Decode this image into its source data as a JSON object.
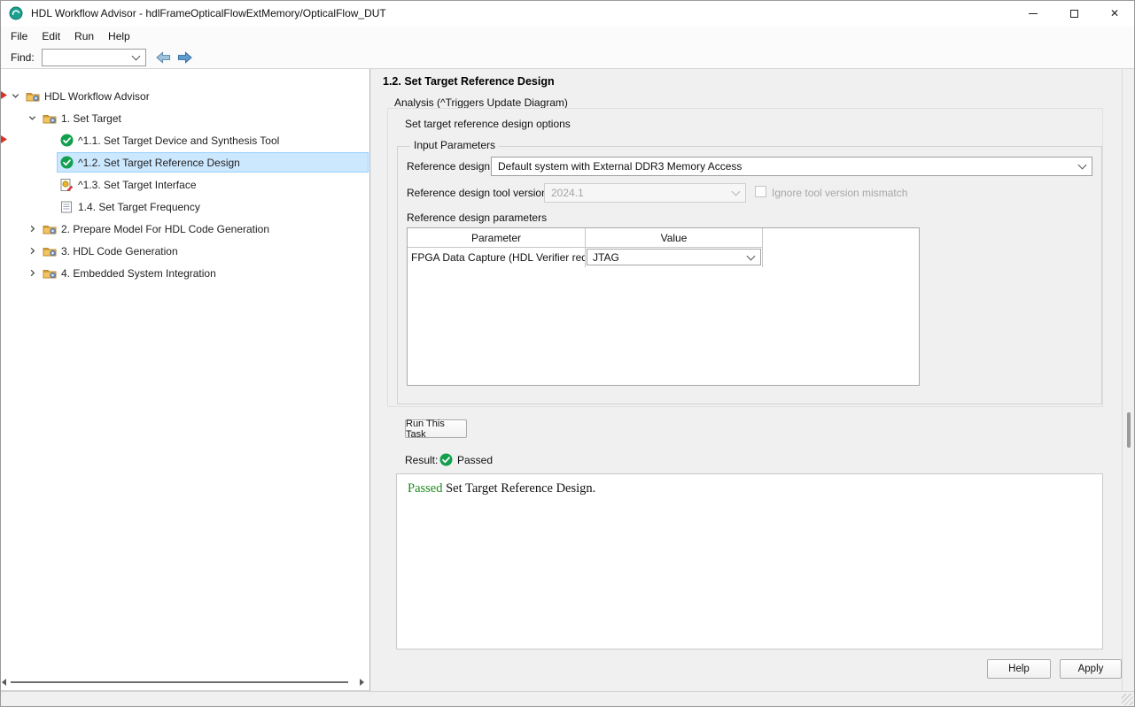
{
  "window": {
    "title": "HDL Workflow Advisor - hdlFrameOpticalFlowExtMemory/OpticalFlow_DUT"
  },
  "menu": {
    "items": [
      "File",
      "Edit",
      "Run",
      "Help"
    ]
  },
  "toolbar": {
    "find_label": "Find:",
    "find_value": ""
  },
  "tree": {
    "items": [
      {
        "label": "HDL Workflow Advisor",
        "level": 0,
        "icon": "workflow-folder",
        "chevron": "expanded",
        "selected": false
      },
      {
        "label": "1. Set Target",
        "level": 1,
        "icon": "task-folder",
        "chevron": "expanded",
        "selected": false
      },
      {
        "label": "^1.1. Set Target Device and Synthesis Tool",
        "level": 2,
        "icon": "passed-check",
        "chevron": "none",
        "selected": false
      },
      {
        "label": "^1.2. Set Target Reference Design",
        "level": 2,
        "icon": "passed-check",
        "chevron": "none",
        "selected": true
      },
      {
        "label": "^1.3. Set Target Interface",
        "level": 2,
        "icon": "task-edit",
        "chevron": "none",
        "selected": false
      },
      {
        "label": "1.4. Set Target Frequency",
        "level": 2,
        "icon": "report",
        "chevron": "none",
        "selected": false
      },
      {
        "label": "2. Prepare Model For HDL Code Generation",
        "level": 1,
        "icon": "task-folder",
        "chevron": "collapsed",
        "selected": false
      },
      {
        "label": "3. HDL Code Generation",
        "level": 1,
        "icon": "task-folder",
        "chevron": "collapsed",
        "selected": false
      },
      {
        "label": "4. Embedded System Integration",
        "level": 1,
        "icon": "task-folder",
        "chevron": "collapsed",
        "selected": false
      }
    ]
  },
  "panel": {
    "title": "1.2. Set Target Reference Design",
    "analysis_label": "Analysis (^Triggers Update Diagram)",
    "options_label": "Set target reference design options",
    "input_parameters": {
      "legend": "Input Parameters",
      "reference_design": {
        "label": "Reference design:",
        "value": "Default system with External DDR3 Memory Access"
      },
      "tool_version": {
        "label": "Reference design tool version:",
        "value": "2024.1"
      },
      "ignore_mismatch_label": "Ignore tool version mismatch",
      "ignore_mismatch_checked": false,
      "parameters_label": "Reference design parameters",
      "table": {
        "headers": [
          "Parameter",
          "Value"
        ],
        "rows": [
          {
            "parameter": "FPGA Data Capture (HDL Verifier req...",
            "value": "JTAG"
          }
        ]
      }
    },
    "run_button": "Run This Task",
    "result": {
      "label": "Result:",
      "status": "Passed",
      "message_status": "Passed",
      "message_rest": " Set Target Reference Design."
    }
  },
  "footer": {
    "help": "Help",
    "apply": "Apply"
  },
  "colors": {
    "selection_bg": "#cce8ff",
    "selection_border": "#99d1ff",
    "passed_green": "#12a04f",
    "result_message_green": "#1f8a1f"
  }
}
